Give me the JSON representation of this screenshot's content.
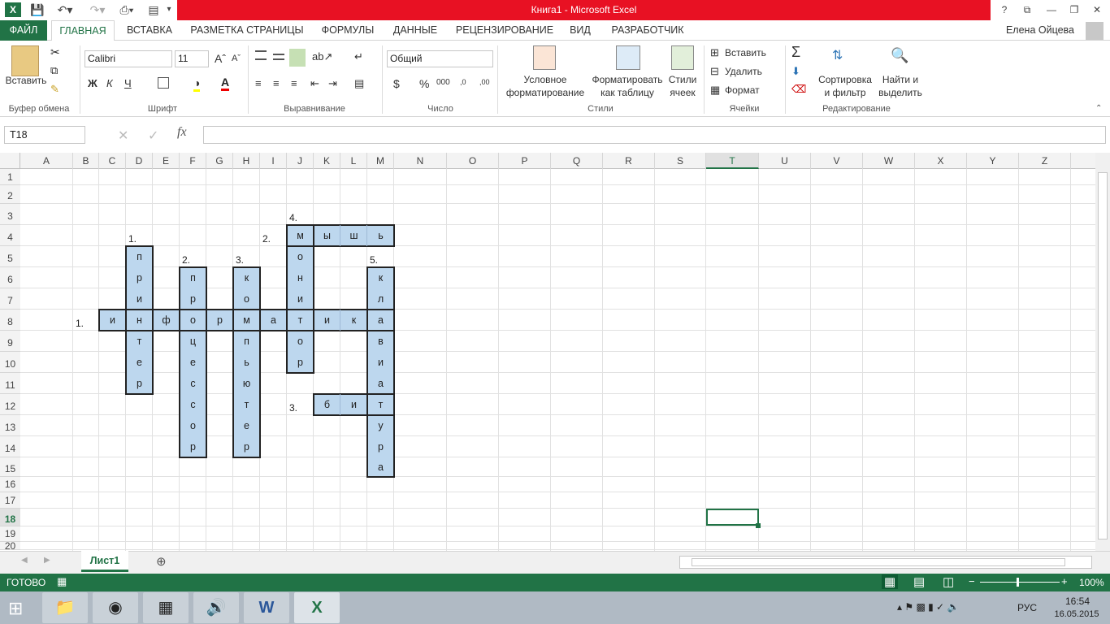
{
  "window": {
    "title": "Книга1 -  Microsoft Excel",
    "help": "?",
    "minimize": "—",
    "maximize": "❐",
    "close": "✕",
    "restore_ribbon": "⧉"
  },
  "tabs": [
    "ФАЙЛ",
    "ГЛАВНАЯ",
    "ВСТАВКА",
    "РАЗМЕТКА СТРАНИЦЫ",
    "ФОРМУЛЫ",
    "ДАННЫЕ",
    "РЕЦЕНЗИРОВАНИЕ",
    "ВИД",
    "РАЗРАБОТЧИК"
  ],
  "user": "Елена Ойцева",
  "ribbon": {
    "clipboard": {
      "paste": "Вставить",
      "group": "Буфер обмена"
    },
    "font": {
      "name": "Calibri",
      "size": "11",
      "bold": "Ж",
      "italic": "К",
      "underline": "Ч",
      "group": "Шрифт"
    },
    "alignment": {
      "group": "Выравнивание"
    },
    "number": {
      "format": "Общий",
      "currency": "$",
      "percent": "%",
      "thousands": "000",
      "inc_dec": ",0→,00",
      "dec_dec": ",00→,0",
      "group": "Число"
    },
    "styles": {
      "conditional_1": "Условное",
      "conditional_2": "форматирование",
      "table_1": "Форматировать",
      "table_2": "как таблицу",
      "cell_1": "Стили",
      "cell_2": "ячеек",
      "group": "Стили"
    },
    "cells": {
      "insert": "Вставить",
      "delete": "Удалить",
      "format": "Формат",
      "group": "Ячейки"
    },
    "editing": {
      "sort_1": "Сортировка",
      "sort_2": "и фильтр",
      "find_1": "Найти и",
      "find_2": "выделить",
      "group": "Редактирование"
    }
  },
  "formula_bar": {
    "name_box": "T18",
    "fx": "fx",
    "value": ""
  },
  "columns": [
    "A",
    "B",
    "C",
    "D",
    "E",
    "F",
    "G",
    "H",
    "I",
    "J",
    "K",
    "L",
    "M",
    "N",
    "O",
    "P",
    "Q",
    "R",
    "S",
    "T",
    "U",
    "V",
    "W",
    "X",
    "Y",
    "Z"
  ],
  "rows": [
    "1",
    "2",
    "3",
    "4",
    "5",
    "6",
    "7",
    "8",
    "9",
    "10",
    "11",
    "12",
    "13",
    "14",
    "15",
    "16",
    "17",
    "18",
    "19",
    "20"
  ],
  "crossword": {
    "labels": [
      {
        "text": "4.",
        "col": "J",
        "row": 3
      },
      {
        "text": "1.",
        "col": "D",
        "row": 4
      },
      {
        "text": "2.",
        "col": "I",
        "row": 4
      },
      {
        "text": "2.",
        "col": "F",
        "row": 5
      },
      {
        "text": "3.",
        "col": "H",
        "row": 5
      },
      {
        "text": "5.",
        "col": "M",
        "row": 5
      },
      {
        "text": "1.",
        "col": "B",
        "row": 8
      },
      {
        "text": "3.",
        "col": "J",
        "row": 12
      }
    ],
    "words": [
      {
        "word": "информатика",
        "col": "C",
        "row": 8,
        "dir": "across"
      },
      {
        "word": "мышь",
        "col": "J",
        "row": 4,
        "dir": "across"
      },
      {
        "word": "бит",
        "col": "K",
        "row": 12,
        "dir": "across"
      },
      {
        "word": "принтер",
        "col": "D",
        "row": 5,
        "dir": "down"
      },
      {
        "word": "процессор",
        "col": "F",
        "row": 6,
        "dir": "down"
      },
      {
        "word": "компьютер",
        "col": "H",
        "row": 6,
        "dir": "down"
      },
      {
        "word": "монитор",
        "col": "J",
        "row": 4,
        "dir": "down"
      },
      {
        "word": "клавиатура",
        "col": "M",
        "row": 6,
        "dir": "down"
      }
    ]
  },
  "sheet": {
    "tab": "Лист1",
    "add": "⊕"
  },
  "status": {
    "ready": "ГОТОВО",
    "zoom": "100%"
  },
  "taskbar": {
    "lang": "РУС",
    "time": "16:54",
    "date": "16.05.2015"
  },
  "colors": {
    "excel_green": "#217346",
    "title_red": "#e81123",
    "cell_fill": "#bdd7ee"
  }
}
